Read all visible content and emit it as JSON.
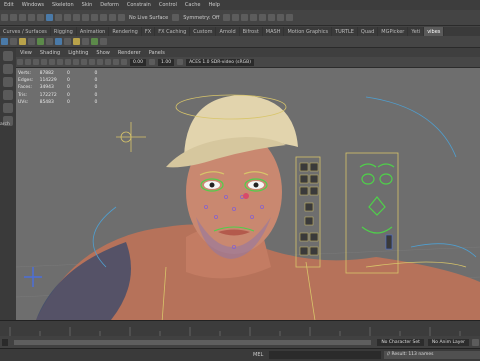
{
  "menubar": {
    "items": [
      "Edit",
      "Windows",
      "Skeleton",
      "Skin",
      "Deform",
      "Constrain",
      "Control",
      "Cache",
      "Help"
    ],
    "dropdowns": [
      "No Live Surface",
      "Symmetry: Off"
    ]
  },
  "shelf_tabs": [
    "Curves / Surfaces",
    "Rigging",
    "Animation",
    "Rendering",
    "FX",
    "FX Caching",
    "Custom",
    "Arnold",
    "Bifrost",
    "MASH",
    "Motion Graphics",
    "TURTLE",
    "Quad",
    "MGPicker",
    "Yeti",
    "vibes"
  ],
  "shelf_tabs_active_index": 15,
  "viewport": {
    "menu": [
      "View",
      "Shading",
      "Lighting",
      "Show",
      "Renderer",
      "Panels"
    ],
    "field_value_1": "0.00",
    "field_value_2": "1.00",
    "color_space": "ACES 1.0 SDR-video (sRGB)"
  },
  "hud": {
    "rows": [
      {
        "label": "Verts:",
        "a": "87882",
        "b": "0",
        "c": "0"
      },
      {
        "label": "Edges:",
        "a": "114229",
        "b": "0",
        "c": "0"
      },
      {
        "label": "Faces:",
        "a": "34943",
        "b": "0",
        "c": "0"
      },
      {
        "label": "Tris:",
        "a": "172272",
        "b": "0",
        "c": "0"
      },
      {
        "label": "UVs:",
        "a": "85483",
        "b": "0",
        "c": "0"
      }
    ]
  },
  "left_panel_text": "arch",
  "range_bar": {
    "character_set": "No Character Set",
    "anim_layer": "No Anim Layer"
  },
  "cmdline": {
    "lang": "MEL",
    "result": "// Result: 113 names"
  },
  "colors": {
    "viewport_bg": "#6e6e6e",
    "rig_yellow": "#d8c56a",
    "rig_green": "#4fd04a",
    "rig_blue": "#4b6fd8",
    "rig_purple": "#8a63c9",
    "accent": "#5a85b5"
  }
}
